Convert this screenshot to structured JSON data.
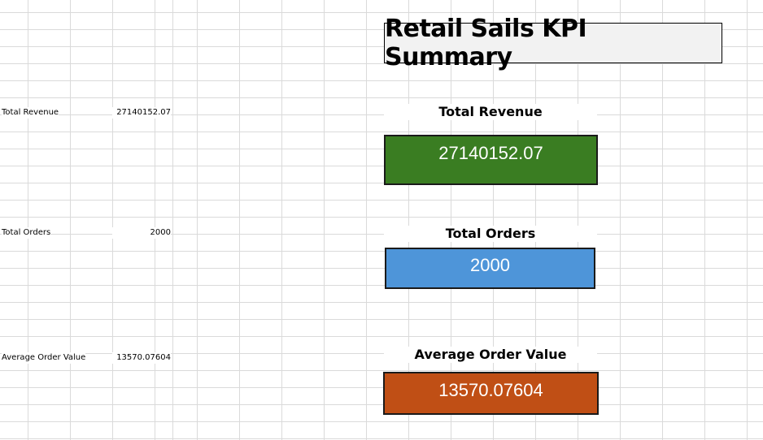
{
  "title": "Retail Sails KPI Summary",
  "table": {
    "rows": [
      {
        "label": "Total Revenue",
        "value": "27140152.07"
      },
      {
        "label": "Total Orders",
        "value": "2000"
      },
      {
        "label": "Average Order Value",
        "value": "13570.07604"
      }
    ]
  },
  "kpis": [
    {
      "heading": "Total Revenue",
      "value": "27140152.07",
      "color": "#3a7d22"
    },
    {
      "heading": "Total Orders",
      "value": "2000",
      "color": "#4e95d9"
    },
    {
      "heading": "Average Order Value",
      "value": "13570.07604",
      "color": "#c04f15"
    }
  ]
}
